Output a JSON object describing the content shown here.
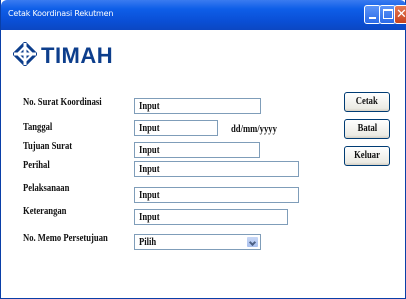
{
  "window": {
    "title": "Cetak Koordinasi Rekutmen"
  },
  "brand": {
    "logo_text": "TIMAH",
    "logo_color": "#0d3e8c"
  },
  "form": {
    "fields": [
      {
        "label": "No. Surat Koordinasi",
        "value": "Input"
      },
      {
        "label": "Tanggal",
        "value": "Input",
        "hint": "dd/mm/yyyy"
      },
      {
        "label": "Tujuan Surat",
        "value": "Input"
      },
      {
        "label": "Perihal",
        "value": "Input"
      },
      {
        "label": "Pelaksanaan",
        "value": "Input"
      },
      {
        "label": "Keterangan",
        "value": "Input"
      },
      {
        "label": "No. Memo Persetujuan",
        "value": "Pilih",
        "type": "select"
      }
    ]
  },
  "actions": {
    "print": "Cetak",
    "cancel": "Batal",
    "exit": "Keluar"
  },
  "colors": {
    "titlebar": "#0a4fd6",
    "field_border": "#7f9db9",
    "button_border": "#003c74"
  }
}
